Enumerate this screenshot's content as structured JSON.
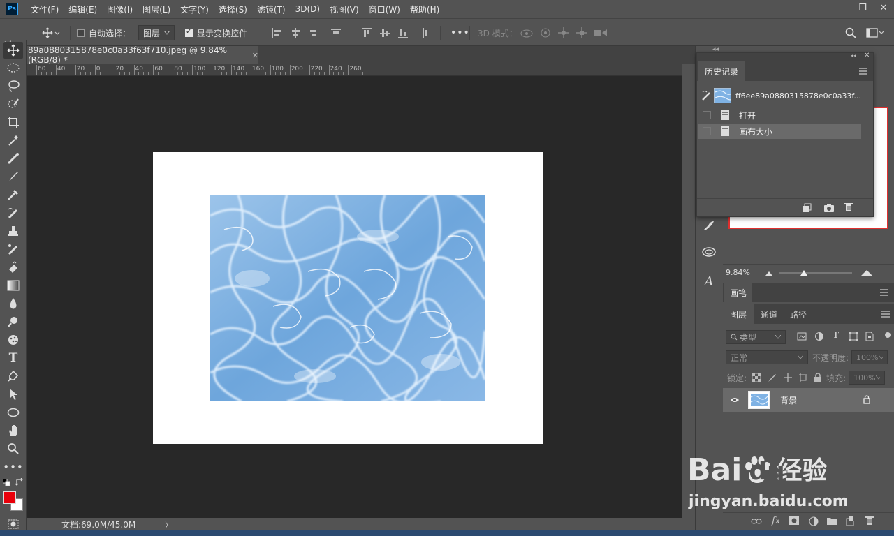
{
  "menu": {
    "logo": "Ps",
    "items": [
      "文件(F)",
      "编辑(E)",
      "图像(I)",
      "图层(L)",
      "文字(Y)",
      "选择(S)",
      "滤镜(T)",
      "3D(D)",
      "视图(V)",
      "窗口(W)",
      "帮助(H)"
    ]
  },
  "window_controls": [
    "—",
    "❐",
    "✕"
  ],
  "options": {
    "auto_select_label": "自动选择：",
    "auto_select_target": "图层",
    "show_transform_label": "显示变换控件",
    "more": "•••",
    "mode_3d_label": "3D 模式："
  },
  "document": {
    "tab_title": "89a0880315878e0c0a33f63f710.jpeg @ 9.84%(RGB/8) *",
    "close": "✕",
    "status_text": "文档:69.0M/45.0M",
    "status_arrow": "〉"
  },
  "ruler": {
    "labels": [
      "60",
      "40",
      "20",
      "0",
      "20",
      "40",
      "60",
      "80",
      "100",
      "120",
      "140",
      "160",
      "180",
      "200",
      "220",
      "240",
      "260"
    ]
  },
  "history": {
    "tab": "历史记录",
    "snapshot_name": "ff6ee89a0880315878e0c0a33f...",
    "steps": [
      {
        "label": "打开",
        "selected": false
      },
      {
        "label": "画布大小",
        "selected": true
      }
    ]
  },
  "navigator": {
    "zoom": "9.84%"
  },
  "brush_panel": {
    "tab": "画笔"
  },
  "layers": {
    "tabs": [
      "图层",
      "通道",
      "路径"
    ],
    "filter_kind": "类型",
    "blend_mode": "正常",
    "opacity_label": "不透明度:",
    "opacity_value": "100%",
    "lock_label": "锁定:",
    "fill_label": "填充:",
    "fill_value": "100%",
    "items": [
      {
        "name": "背景",
        "visible": true,
        "locked": true
      }
    ]
  },
  "watermark": {
    "brand": "Bai",
    "brand2": "du",
    "brand_cn": "经验",
    "url": "jingyan.baidu.com"
  },
  "colors": {
    "foreground": "#e8000a",
    "background": "#ffffff",
    "accent_ps": "#31a8ff",
    "navigator_frame": "#e0302f"
  }
}
